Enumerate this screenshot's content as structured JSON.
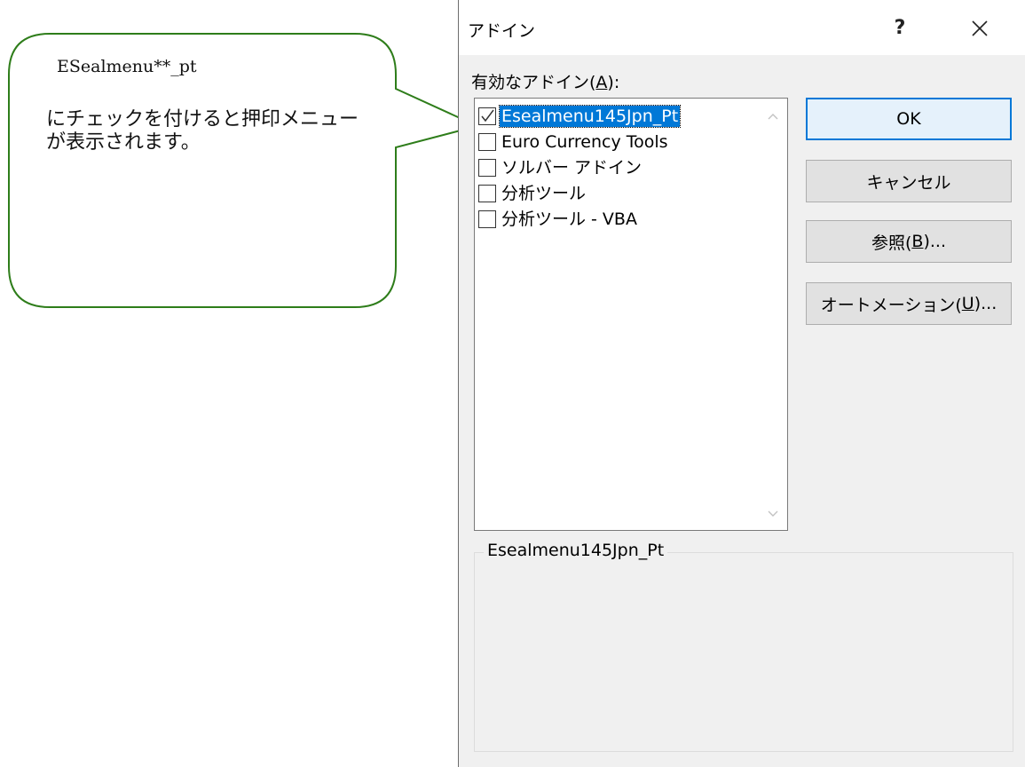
{
  "callout": {
    "title": "ESealmenu**_pt",
    "body": "にチェックを付けると押印メニューが表示されます。",
    "border_color": "#2e7d1a"
  },
  "dialog": {
    "title": "アドイン",
    "help_label": "?",
    "close_icon": "close-icon",
    "addins_label": "有効なアドイン(",
    "addins_accel": "A",
    "addins_suffix": "):",
    "items": [
      {
        "label": "Esealmenu145Jpn_Pt",
        "checked": true,
        "selected": true
      },
      {
        "label": "Euro Currency Tools",
        "checked": false,
        "selected": false
      },
      {
        "label": "ソルバー アドイン",
        "checked": false,
        "selected": false
      },
      {
        "label": "分析ツール",
        "checked": false,
        "selected": false
      },
      {
        "label": "分析ツール - VBA",
        "checked": false,
        "selected": false
      }
    ],
    "buttons": {
      "ok": "OK",
      "cancel": "キャンセル",
      "browse_prefix": "参照(",
      "browse_accel": "B",
      "browse_suffix": ")...",
      "automation_prefix": "オートメーション(",
      "automation_accel": "U",
      "automation_suffix": ")..."
    },
    "description_title": "Esealmenu145Jpn_Pt",
    "accent_color": "#0078d7"
  }
}
